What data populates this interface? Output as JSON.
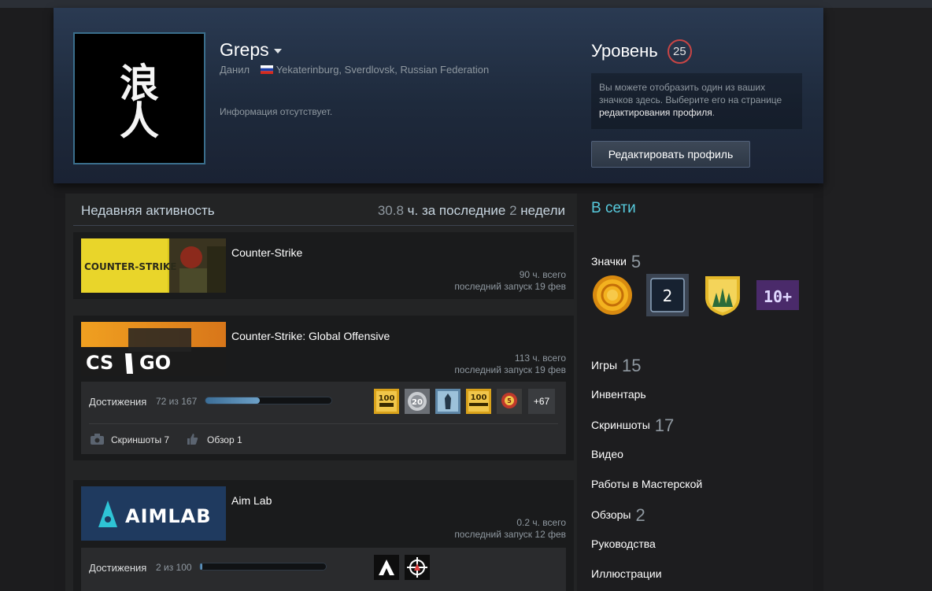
{
  "profile": {
    "name": "Greps",
    "real_name": "Данил",
    "location": "Yekaterinburg, Sverdlovsk, Russian Federation",
    "summary": "Информация отсутствует.",
    "level_label": "Уровень",
    "level": "25",
    "badge_hint_1": "Вы можете отобразить один из ваших значков здесь. Выберите его на странице",
    "badge_hint_link": "редактирования профиля",
    "badge_hint_2": ".",
    "edit_button": "Редактировать профиль"
  },
  "activity": {
    "title": "Недавняя активность",
    "hours": "30.8",
    "hours_mid": "ч. за последние",
    "weeks": "2",
    "weeks_label": "недели"
  },
  "games": [
    {
      "name": "Counter-Strike",
      "hours": "90 ч. всего",
      "last": "последний запуск 19 фев"
    },
    {
      "name": "Counter-Strike: Global Offensive",
      "hours": "113 ч. всего",
      "last": "последний запуск 19 фев",
      "ach_label": "Достижения",
      "ach_count": "72 из 167",
      "ach_progress": 0.43,
      "ach_more": "+67",
      "screens_label": "Скриншоты 7",
      "review_label": "Обзор 1"
    },
    {
      "name": "Aim Lab",
      "hours": "0.2 ч. всего",
      "last": "последний запуск 12 фев",
      "ach_label": "Достижения",
      "ach_count": "2 из 100",
      "ach_progress": 0.02
    }
  ],
  "capsules": {
    "cs": "COUNTER-STRIKE",
    "csgo_left": "CS",
    "csgo_right": "GO",
    "aimlab": "AIMLAB"
  },
  "avatar_text": "浪人",
  "sidebar": {
    "online": "В сети",
    "badges_label": "Значки",
    "badges_count": "5",
    "badge_two": "2",
    "badge_ten": "10+",
    "games_label": "Игры",
    "games_count": "15",
    "inventory": "Инвентарь",
    "screenshots_label": "Скриншоты",
    "screenshots_count": "17",
    "video": "Видео",
    "workshop": "Работы в Мастерской",
    "reviews_label": "Обзоры",
    "reviews_count": "2",
    "guides": "Руководства",
    "artwork": "Иллюстрации"
  },
  "achievement_icons": [
    "100",
    "20",
    "100",
    "5"
  ],
  "colors": {
    "online": "#57cbde",
    "level_ring": "#c84545",
    "bar": "#6da1c8"
  }
}
